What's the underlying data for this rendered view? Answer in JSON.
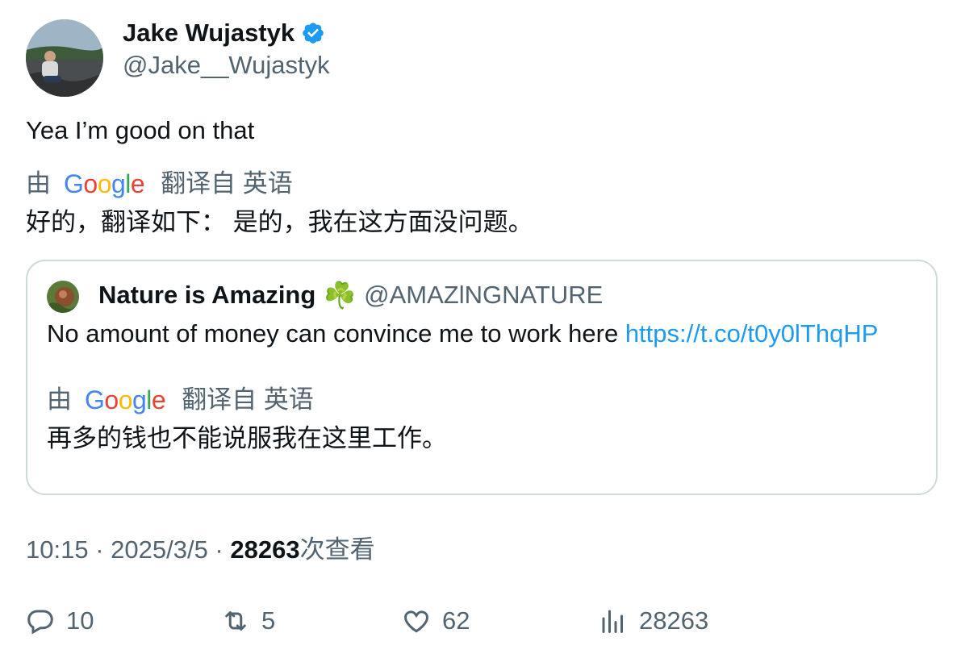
{
  "author": {
    "name": "Jake Wujastyk",
    "handle": "@Jake__Wujastyk",
    "verified": true,
    "avatar_icon": "profile-photo"
  },
  "tweet": {
    "text": "Yea I’m good on that",
    "translation": {
      "by_label": "由",
      "provider": "Google",
      "from_label": "翻译自 英语",
      "text": "好的，翻译如下： 是的，我在这方面没问题。"
    }
  },
  "quoted_tweet": {
    "name": "Nature is Amazing",
    "emoji": "☘️",
    "handle": "@AMAZlNGNATURE",
    "text": "No amount of money can convince me to work here",
    "link": "https://t.co/t0y0lThqHP",
    "translation": {
      "by_label": "由",
      "provider": "Google",
      "from_label": "翻译自 英语",
      "text": "再多的钱也不能说服我在这里工作。"
    }
  },
  "meta": {
    "time": "10:15",
    "sep1": " · ",
    "date": "2025/3/5",
    "sep2": " · ",
    "views": "28263",
    "views_label": "次查看"
  },
  "actions": {
    "replies": "10",
    "retweets": "5",
    "likes": "62",
    "views": "28263"
  },
  "colors": {
    "text": "#0f1419",
    "secondary": "#536471",
    "link": "#1d9bf0",
    "border": "#cfd9de",
    "verified": "#1d9bf0"
  }
}
